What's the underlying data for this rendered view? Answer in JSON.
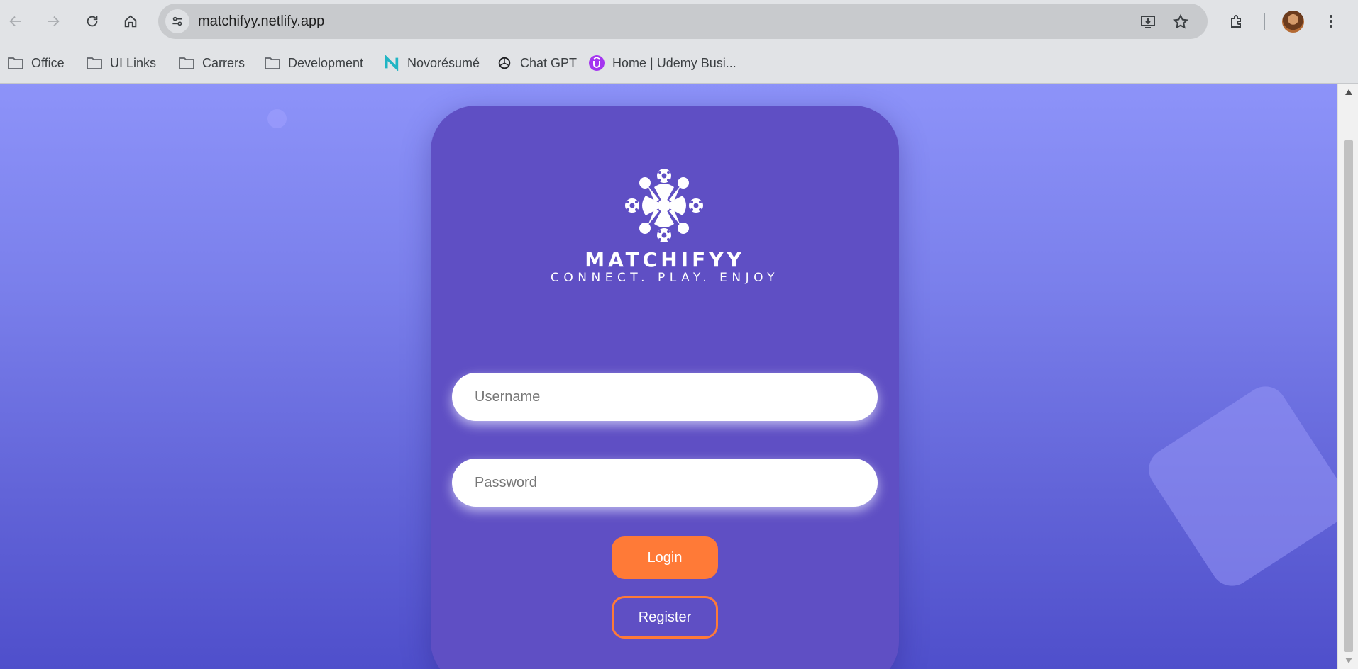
{
  "browser": {
    "url": "matchifyy.netlify.app",
    "bookmarks": [
      {
        "label": "Office",
        "icon": "folder-icon"
      },
      {
        "label": "UI Links",
        "icon": "folder-icon"
      },
      {
        "label": "Carrers",
        "icon": "folder-icon"
      },
      {
        "label": "Development",
        "icon": "folder-icon"
      },
      {
        "label": "Novorésumé",
        "icon": "novoresume-icon"
      },
      {
        "label": "Chat GPT",
        "icon": "chatgpt-icon"
      },
      {
        "label": "Home | Udemy Busi...",
        "icon": "udemy-icon"
      }
    ]
  },
  "page": {
    "brand": "MATCHIFYY",
    "tagline": "CONNECT. PLAY. ENJOY",
    "username_placeholder": "Username",
    "password_placeholder": "Password",
    "login_label": "Login",
    "register_label": "Register"
  },
  "colors": {
    "card": "#5f4fc4",
    "accent": "#ff7a37",
    "background_top": "#8d93f9",
    "background_bottom": "#4f4fcb"
  }
}
